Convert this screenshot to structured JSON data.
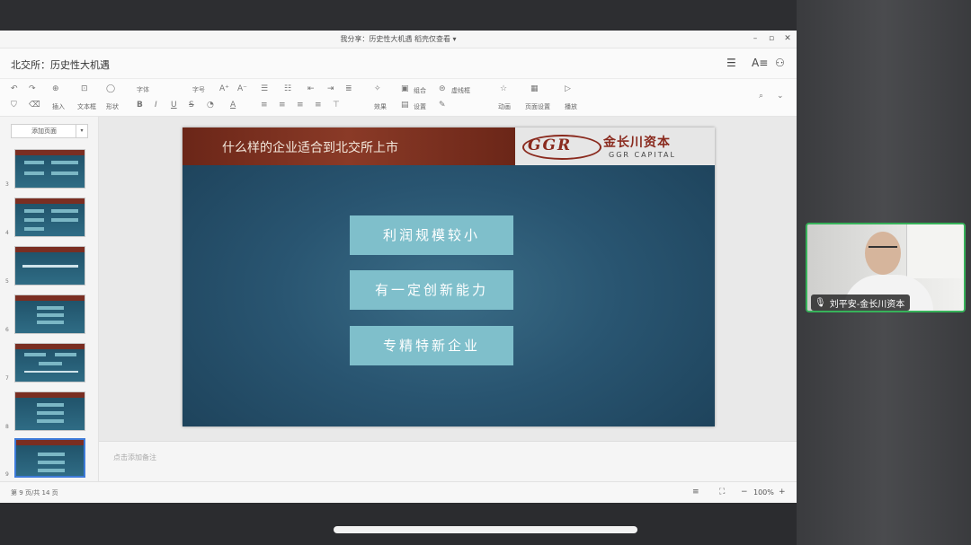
{
  "window": {
    "title": "我分享：历史性大机遇   稻壳仅查看 ▾",
    "minimize_icon": "minimize-icon",
    "maximize_icon": "maximize-icon",
    "close_icon": "close-icon"
  },
  "doc": {
    "title": "北交所：历史性大机遇"
  },
  "toolbar": {
    "insert_label": "插入",
    "textbox_label": "文本框",
    "shape_label": "形状",
    "font_placeholder": "字体",
    "font_size": "字号",
    "effect_label": "效果",
    "group_label": "组合",
    "set_label": "设置",
    "dashed_label": "虚线框",
    "animation_label": "动画",
    "slide_settings_label": "页面设置",
    "play_label": "播放"
  },
  "left_panel": {
    "add_slide_label": "添加页面",
    "thumb_numbers": [
      "3",
      "4",
      "5",
      "6",
      "7",
      "8",
      "9"
    ]
  },
  "slide": {
    "title": "什么样的企业适合到北交所上市",
    "logo_mark": "GGR",
    "logo_cn": "金长川资本",
    "logo_en": "GGR CAPITAL",
    "boxes": [
      "利润规模较小",
      "有一定创新能力",
      "专精特新企业"
    ]
  },
  "notes": {
    "placeholder": "点击添加备注"
  },
  "status": {
    "page_info": "第 9 页/共 14 页",
    "zoom": "100%"
  },
  "video": {
    "participant_name": "刘平安-金长川资本"
  },
  "colors": {
    "accent_green": "#37b25a",
    "slide_header_red": "#7a2e22",
    "slide_box_teal": "#7fbfcb"
  }
}
